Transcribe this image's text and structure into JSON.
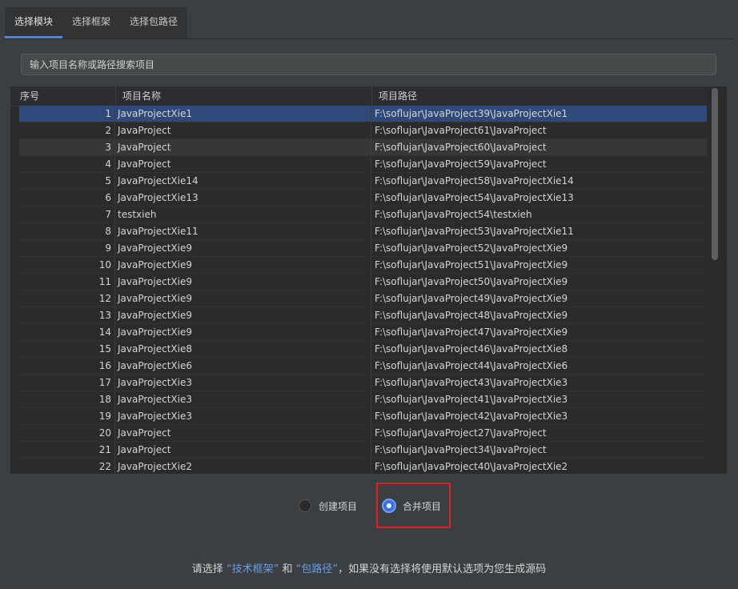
{
  "tabs": [
    {
      "label": "选择模块",
      "active": true
    },
    {
      "label": "选择框架",
      "active": false
    },
    {
      "label": "选择包路径",
      "active": false
    }
  ],
  "search": {
    "placeholder": "输入项目名称或路径搜索项目",
    "value": ""
  },
  "table": {
    "headers": [
      "序号",
      "项目名称",
      "项目路径"
    ],
    "rows": [
      {
        "num": "1",
        "name": "JavaProjectXie1",
        "path": "F:\\soflujar\\JavaProject39\\JavaProjectXie1"
      },
      {
        "num": "2",
        "name": "JavaProject",
        "path": "F:\\soflujar\\JavaProject61\\JavaProject"
      },
      {
        "num": "3",
        "name": "JavaProject",
        "path": "F:\\soflujar\\JavaProject60\\JavaProject"
      },
      {
        "num": "4",
        "name": "JavaProject",
        "path": "F:\\soflujar\\JavaProject59\\JavaProject"
      },
      {
        "num": "5",
        "name": "JavaProjectXie14",
        "path": "F:\\soflujar\\JavaProject58\\JavaProjectXie14"
      },
      {
        "num": "6",
        "name": "JavaProjectXie13",
        "path": "F:\\soflujar\\JavaProject54\\JavaProjectXie13"
      },
      {
        "num": "7",
        "name": "testxieh",
        "path": "F:\\soflujar\\JavaProject54\\testxieh"
      },
      {
        "num": "8",
        "name": "JavaProjectXie11",
        "path": "F:\\soflujar\\JavaProject53\\JavaProjectXie11"
      },
      {
        "num": "9",
        "name": "JavaProjectXie9",
        "path": "F:\\soflujar\\JavaProject52\\JavaProjectXie9"
      },
      {
        "num": "10",
        "name": "JavaProjectXie9",
        "path": "F:\\soflujar\\JavaProject51\\JavaProjectXie9"
      },
      {
        "num": "11",
        "name": "JavaProjectXie9",
        "path": "F:\\soflujar\\JavaProject50\\JavaProjectXie9"
      },
      {
        "num": "12",
        "name": "JavaProjectXie9",
        "path": "F:\\soflujar\\JavaProject49\\JavaProjectXie9"
      },
      {
        "num": "13",
        "name": "JavaProjectXie9",
        "path": "F:\\soflujar\\JavaProject48\\JavaProjectXie9"
      },
      {
        "num": "14",
        "name": "JavaProjectXie9",
        "path": "F:\\soflujar\\JavaProject47\\JavaProjectXie9"
      },
      {
        "num": "15",
        "name": "JavaProjectXie8",
        "path": "F:\\soflujar\\JavaProject46\\JavaProjectXie8"
      },
      {
        "num": "16",
        "name": "JavaProjectXie6",
        "path": "F:\\soflujar\\JavaProject44\\JavaProjectXie6"
      },
      {
        "num": "17",
        "name": "JavaProjectXie3",
        "path": "F:\\soflujar\\JavaProject43\\JavaProjectXie3"
      },
      {
        "num": "18",
        "name": "JavaProjectXie3",
        "path": "F:\\soflujar\\JavaProject41\\JavaProjectXie3"
      },
      {
        "num": "19",
        "name": "JavaProjectXie3",
        "path": "F:\\soflujar\\JavaProject42\\JavaProjectXie3"
      },
      {
        "num": "20",
        "name": "JavaProject",
        "path": "F:\\soflujar\\JavaProject27\\JavaProject"
      },
      {
        "num": "21",
        "name": "JavaProject",
        "path": "F:\\soflujar\\JavaProject34\\JavaProject"
      },
      {
        "num": "22",
        "name": "JavaProjectXie2",
        "path": "F:\\soflujar\\JavaProject40\\JavaProjectXie2"
      }
    ]
  },
  "options": {
    "create_label": "创建项目",
    "merge_label": "合并项目",
    "selected": "merge"
  },
  "hint": {
    "prefix": "请选择 ",
    "link1": "“技术框架”",
    "middle": " 和 ",
    "link2": "“包路径”",
    "suffix": "，如果没有选择将使用默认选项为您生成源码"
  },
  "colors": {
    "accent": "#4a88e0",
    "selected_row": "#2f4a7a",
    "highlight_box": "#e02020",
    "link": "#6a9ce8"
  }
}
